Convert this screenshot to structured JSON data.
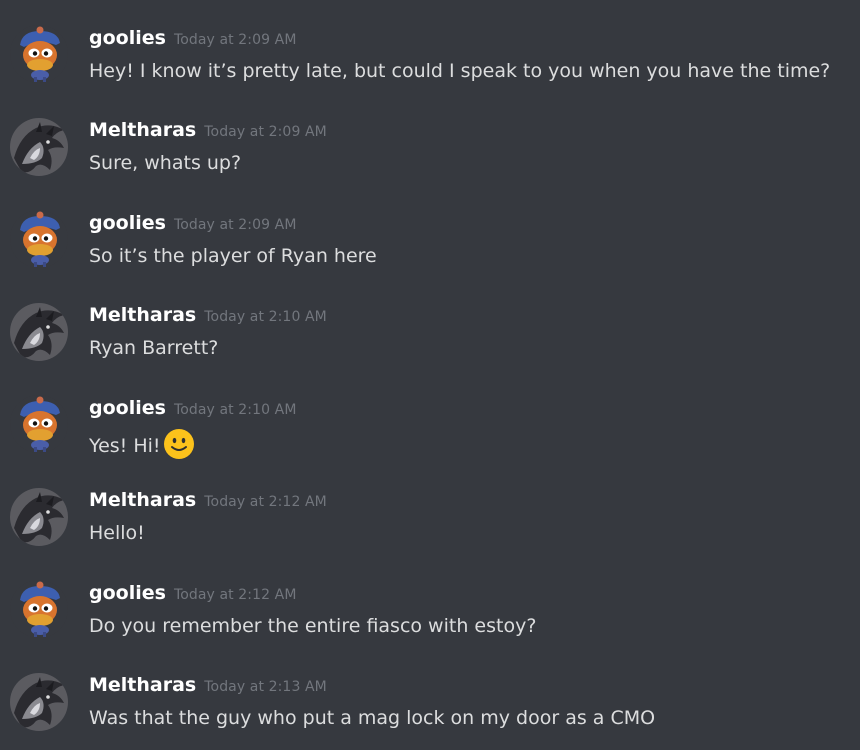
{
  "colors": {
    "background": "#36393f",
    "username": "#ffffff",
    "timestamp": "#72767d",
    "message_text": "#dcddde",
    "emoji": "#fcc21b"
  },
  "users": {
    "goolies": {
      "avatar_icon": "duck-with-blue-hat-icon"
    },
    "Meltharas": {
      "avatar_icon": "dragon-icon"
    }
  },
  "messages": [
    {
      "author": "goolies",
      "timestamp": "Today at 2:09 AM",
      "text": "Hey! I know it’s pretty late, but could I speak to you when you have the time?"
    },
    {
      "author": "Meltharas",
      "timestamp": "Today at 2:09 AM",
      "text": "Sure, whats up?"
    },
    {
      "author": "goolies",
      "timestamp": "Today at 2:09 AM",
      "text": "So it’s the player of Ryan here"
    },
    {
      "author": "Meltharas",
      "timestamp": "Today at 2:10 AM",
      "text": "Ryan Barrett?"
    },
    {
      "author": "goolies",
      "timestamp": "Today at 2:10 AM",
      "text": "Yes! Hi!",
      "emoji": "slightly-smiling-face-icon"
    },
    {
      "author": "Meltharas",
      "timestamp": "Today at 2:12 AM",
      "text": "Hello!"
    },
    {
      "author": "goolies",
      "timestamp": "Today at 2:12 AM",
      "text": "Do you remember the entire fiasco with estoy?"
    },
    {
      "author": "Meltharas",
      "timestamp": "Today at 2:13 AM",
      "text": "Was that the guy who put a mag lock on my door as a CMO"
    }
  ]
}
